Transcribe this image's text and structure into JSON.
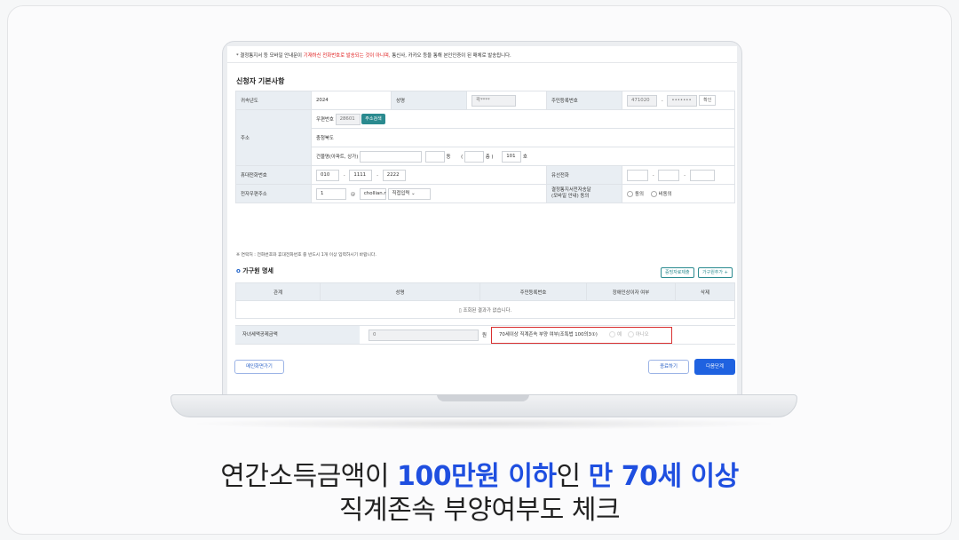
{
  "notice": {
    "prefix": "* 결정통지서 등 모바일 안내문이",
    "highlight": "기재하신 전화번호로 발송되는 것이 아니며,",
    "suffix": "통신사, 카카오 등을 통해 본인인증이 된 매체로 발송됩니다."
  },
  "section_title": "신청자 기본사항",
  "form": {
    "year_label": "귀속년도",
    "year_value": "2024",
    "name_label": "성명",
    "name_value": "곽****",
    "rrn_label": "주민등록번호",
    "rrn_front": "471020",
    "rrn_back": "•••••••",
    "rrn_confirm": "확인",
    "address_label": "주소",
    "zip_label": "우편번호",
    "zip_value": "28601",
    "zip_search": "주소검색",
    "region": "충청북도",
    "building_label": "건물명(아파트, 상가)",
    "dong_suffix": "동",
    "floor_suffix": "층 )",
    "ho_value": "101",
    "ho_suffix": "호",
    "mobile_label": "휴대전화번호",
    "mobile_1": "010",
    "mobile_2": "1111",
    "mobile_3": "2222",
    "landline_label": "유선전화",
    "email_label": "전자우편주소",
    "email_id": "1",
    "email_domain": "chollian.r",
    "email_select": "직접입력",
    "consent_label_1": "결정통지서전자송달",
    "consent_label_2": "(모바일 안내) 동의",
    "consent_yes": "동의",
    "consent_no": "비동의"
  },
  "note": "※ 연락처 : 전화번호와 휴대전화번호 중 반드시 1개 이상 입력하시기 바랍니다.",
  "household": {
    "title": "가구원 명세",
    "btn_docs": "증빙자료제출",
    "btn_add": "가구원추가 +",
    "columns": [
      "관계",
      "성명",
      "주민등록번호",
      "장애인상이자 여부",
      "삭제"
    ],
    "empty": "조회된 결과가 없습니다."
  },
  "tax": {
    "label": "자녀세액공제금액",
    "value": "0",
    "unit": "원",
    "question": "70세이상 직계존속 부양 여부(조특법 100의3①)",
    "yes": "예",
    "no": "아니오"
  },
  "buttons": {
    "back": "메인화면가기",
    "save": "종료하기",
    "next": "다음단계"
  },
  "caption": {
    "line1_a": "연간소득금액이 ",
    "line1_b": "100만원 이하",
    "line1_c": "인 ",
    "line1_d": "만 70세 이상",
    "line2": "직계존속 부양여부도 체크"
  },
  "colors": {
    "accent_blue": "#1f4fe0",
    "teal": "#2a8a8f",
    "highlight_red": "#d93030"
  }
}
